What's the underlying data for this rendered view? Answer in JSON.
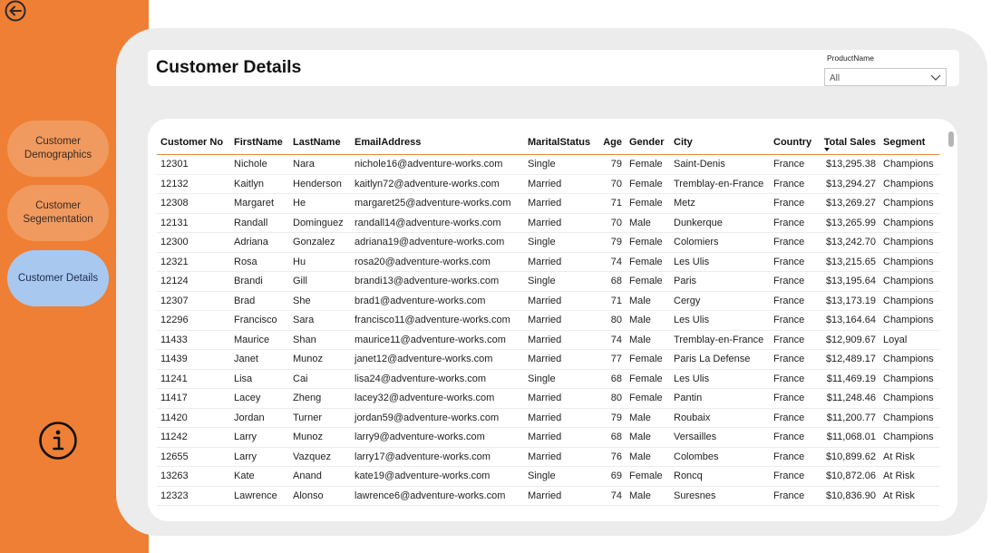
{
  "sidebar": {
    "nav": [
      {
        "label": "Customer Demographics",
        "active": false
      },
      {
        "label": "Customer Segementation",
        "active": false
      },
      {
        "label": "Customer Details",
        "active": true
      }
    ]
  },
  "header": {
    "title": "Customer Details"
  },
  "slicer": {
    "label": "ProductName",
    "value": "All"
  },
  "table": {
    "columns": [
      "Customer No",
      "FirstName",
      "LastName",
      "EmailAddress",
      "MaritalStatus",
      "Age",
      "Gender",
      "City",
      "Country",
      "Total Sales",
      "Segment"
    ],
    "sorted_column": "Total Sales",
    "rows": [
      [
        "12301",
        "Nichole",
        "Nara",
        "nichole16@adventure-works.com",
        "Single",
        "79",
        "Female",
        "Saint-Denis",
        "France",
        "$13,295.38",
        "Champions"
      ],
      [
        "12132",
        "Kaitlyn",
        "Henderson",
        "kaitlyn72@adventure-works.com",
        "Married",
        "70",
        "Female",
        "Tremblay-en-France",
        "France",
        "$13,294.27",
        "Champions"
      ],
      [
        "12308",
        "Margaret",
        "He",
        "margaret25@adventure-works.com",
        "Married",
        "71",
        "Female",
        "Metz",
        "France",
        "$13,269.27",
        "Champions"
      ],
      [
        "12131",
        "Randall",
        "Dominguez",
        "randall14@adventure-works.com",
        "Married",
        "70",
        "Male",
        "Dunkerque",
        "France",
        "$13,265.99",
        "Champions"
      ],
      [
        "12300",
        "Adriana",
        "Gonzalez",
        "adriana19@adventure-works.com",
        "Single",
        "79",
        "Female",
        "Colomiers",
        "France",
        "$13,242.70",
        "Champions"
      ],
      [
        "12321",
        "Rosa",
        "Hu",
        "rosa20@adventure-works.com",
        "Married",
        "74",
        "Female",
        "Les Ulis",
        "France",
        "$13,215.65",
        "Champions"
      ],
      [
        "12124",
        "Brandi",
        "Gill",
        "brandi13@adventure-works.com",
        "Single",
        "68",
        "Female",
        "Paris",
        "France",
        "$13,195.64",
        "Champions"
      ],
      [
        "12307",
        "Brad",
        "She",
        "brad1@adventure-works.com",
        "Married",
        "71",
        "Male",
        "Cergy",
        "France",
        "$13,173.19",
        "Champions"
      ],
      [
        "12296",
        "Francisco",
        "Sara",
        "francisco11@adventure-works.com",
        "Married",
        "80",
        "Male",
        "Les Ulis",
        "France",
        "$13,164.64",
        "Champions"
      ],
      [
        "11433",
        "Maurice",
        "Shan",
        "maurice11@adventure-works.com",
        "Married",
        "74",
        "Male",
        "Tremblay-en-France",
        "France",
        "$12,909.67",
        "Loyal"
      ],
      [
        "11439",
        "Janet",
        "Munoz",
        "janet12@adventure-works.com",
        "Married",
        "77",
        "Female",
        "Paris La Defense",
        "France",
        "$12,489.17",
        "Champions"
      ],
      [
        "11241",
        "Lisa",
        "Cai",
        "lisa24@adventure-works.com",
        "Single",
        "68",
        "Female",
        "Les Ulis",
        "France",
        "$11,469.19",
        "Champions"
      ],
      [
        "11417",
        "Lacey",
        "Zheng",
        "lacey32@adventure-works.com",
        "Married",
        "80",
        "Female",
        "Pantin",
        "France",
        "$11,248.46",
        "Champions"
      ],
      [
        "11420",
        "Jordan",
        "Turner",
        "jordan59@adventure-works.com",
        "Married",
        "79",
        "Male",
        "Roubaix",
        "France",
        "$11,200.77",
        "Champions"
      ],
      [
        "11242",
        "Larry",
        "Munoz",
        "larry9@adventure-works.com",
        "Married",
        "68",
        "Male",
        "Versailles",
        "France",
        "$11,068.01",
        "Champions"
      ],
      [
        "12655",
        "Larry",
        "Vazquez",
        "larry17@adventure-works.com",
        "Married",
        "76",
        "Male",
        "Colombes",
        "France",
        "$10,899.62",
        "At Risk"
      ],
      [
        "13263",
        "Kate",
        "Anand",
        "kate19@adventure-works.com",
        "Single",
        "69",
        "Female",
        "Roncq",
        "France",
        "$10,872.06",
        "At Risk"
      ],
      [
        "12323",
        "Lawrence",
        "Alonso",
        "lawrence6@adventure-works.com",
        "Married",
        "74",
        "Male",
        "Suresnes",
        "France",
        "$10,836.90",
        "At Risk"
      ]
    ]
  },
  "colors": {
    "sidebar": "#ef7f35",
    "nav_button": "#f19a5f",
    "nav_active": "#a9c8f0",
    "panel": "#ececec",
    "header_rule": "#e8852f"
  },
  "icons": {
    "back": "back-arrow-circle-icon",
    "info": "info-circle-icon",
    "dropdown": "chevron-down-icon",
    "sort": "sort-descending-icon"
  }
}
